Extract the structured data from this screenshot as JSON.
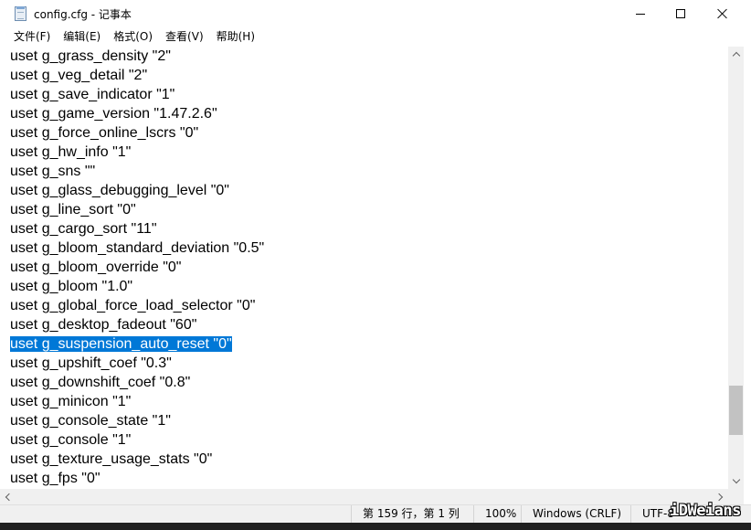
{
  "window": {
    "title": "config.cfg - 记事本",
    "app_icon": "notepad-icon"
  },
  "menu": {
    "items": [
      {
        "label": "文件(F)"
      },
      {
        "label": "编辑(E)"
      },
      {
        "label": "格式(O)"
      },
      {
        "label": "查看(V)"
      },
      {
        "label": "帮助(H)"
      }
    ]
  },
  "editor": {
    "selected_line_index": 15,
    "lines": [
      "uset g_grass_density \"2\"",
      "uset g_veg_detail \"2\"",
      "uset g_save_indicator \"1\"",
      "uset g_game_version \"1.47.2.6\"",
      "uset g_force_online_lscrs \"0\"",
      "uset g_hw_info \"1\"",
      "uset g_sns \"\"",
      "uset g_glass_debugging_level \"0\"",
      "uset g_line_sort \"0\"",
      "uset g_cargo_sort \"11\"",
      "uset g_bloom_standard_deviation \"0.5\"",
      "uset g_bloom_override \"0\"",
      "uset g_bloom \"1.0\"",
      "uset g_global_force_load_selector \"0\"",
      "uset g_desktop_fadeout \"60\"",
      "uset g_suspension_auto_reset \"0\"",
      "uset g_upshift_coef \"0.3\"",
      "uset g_downshift_coef \"0.8\"",
      "uset g_minicon \"1\"",
      "uset g_console_state \"1\"",
      "uset g_console \"1\"",
      "uset g_texture_usage_stats \"0\"",
      "uset g_fps \"0\""
    ]
  },
  "scrollbar": {
    "vertical_position_fraction": 0.84
  },
  "status": {
    "position": "第 159 行，第 1 列",
    "zoom": "100%",
    "line_ending": "Windows (CRLF)",
    "encoding": "UTF-8"
  },
  "watermark": {
    "text": "iDWeians"
  },
  "colors": {
    "selection": "#0078d7",
    "statusbar": "#f0f0f0",
    "scrollbar_thumb": "#c2c2c2"
  }
}
